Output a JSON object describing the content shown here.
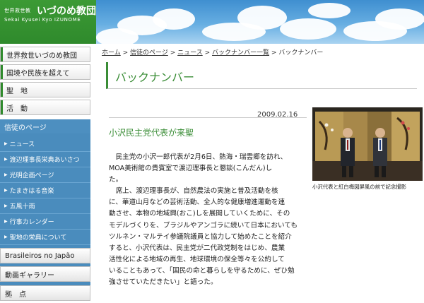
{
  "header": {
    "logo_small": "世界救世教",
    "logo_big": "いづのめ教団",
    "logo_roman": "Sekai Kyusei Kyo IZUNOME"
  },
  "sidebar": {
    "items": [
      {
        "label": "世界救世いづのめ教団"
      },
      {
        "label": "国境や民族を超えて"
      },
      {
        "label": "聖　地"
      },
      {
        "label": "活　動"
      }
    ],
    "section_header": "信徒のページ",
    "sub_items": [
      {
        "label": "ニュース"
      },
      {
        "label": "渡辺理事長栄典あいさつ"
      },
      {
        "label": "光明企画ページ"
      },
      {
        "label": "たまきはる音楽"
      },
      {
        "label": "五風十雨"
      },
      {
        "label": "行事カレンダー"
      },
      {
        "label": "聖地の栄典について"
      }
    ],
    "bottom_items": [
      {
        "label": "Brasileiros no Japão"
      },
      {
        "label": "動画ギャラリー"
      },
      {
        "label": "拠　点"
      }
    ]
  },
  "breadcrumb": {
    "items": [
      "ホーム",
      "信徒のページ",
      "ニュース",
      "バックナンバー一覧"
    ],
    "current": "バックナンバー",
    "separator": ">"
  },
  "page": {
    "title": "バックナンバー"
  },
  "article": {
    "date": "2009.02.16",
    "title": "小沢民主党代表が来聖",
    "lines": [
      "　民主党の小沢一郎代表が2月6日、熱海・瑞雲郷を訪れ、",
      "MOA美術館の貴賓室で渡辺理事長と懇談(こんだん)し",
      "た。",
      "　席上、渡辺理事長が、自然農法の実施と普及活動を核",
      "に、華道山月などの芸術活動、全人的な健康増進運動を連",
      "動させ、本物の地域興(おこ)しを展開していくために、その",
      "モデルづくりを、ブラジルやアンゴラに続いて日本においても",
      "ツルネン・マルテイ参議院議員と協力して始めたことを紹介",
      "すると、小沢代表は、民主党が二代政党制をはじめ、農業",
      "活性化による地域の再生、地球環境の保全等々を公約して",
      "いることもあって、「国民の命と暮らしを守るために、ぜひ勉",
      "強させていただきたい」と語った。"
    ],
    "photo_caption": "小沢代表と紅白梅図屏風の前で記念撮影"
  },
  "colors": {
    "green": "#3a8d36",
    "blue": "#4a8cbd",
    "sky": "#67aee2"
  }
}
